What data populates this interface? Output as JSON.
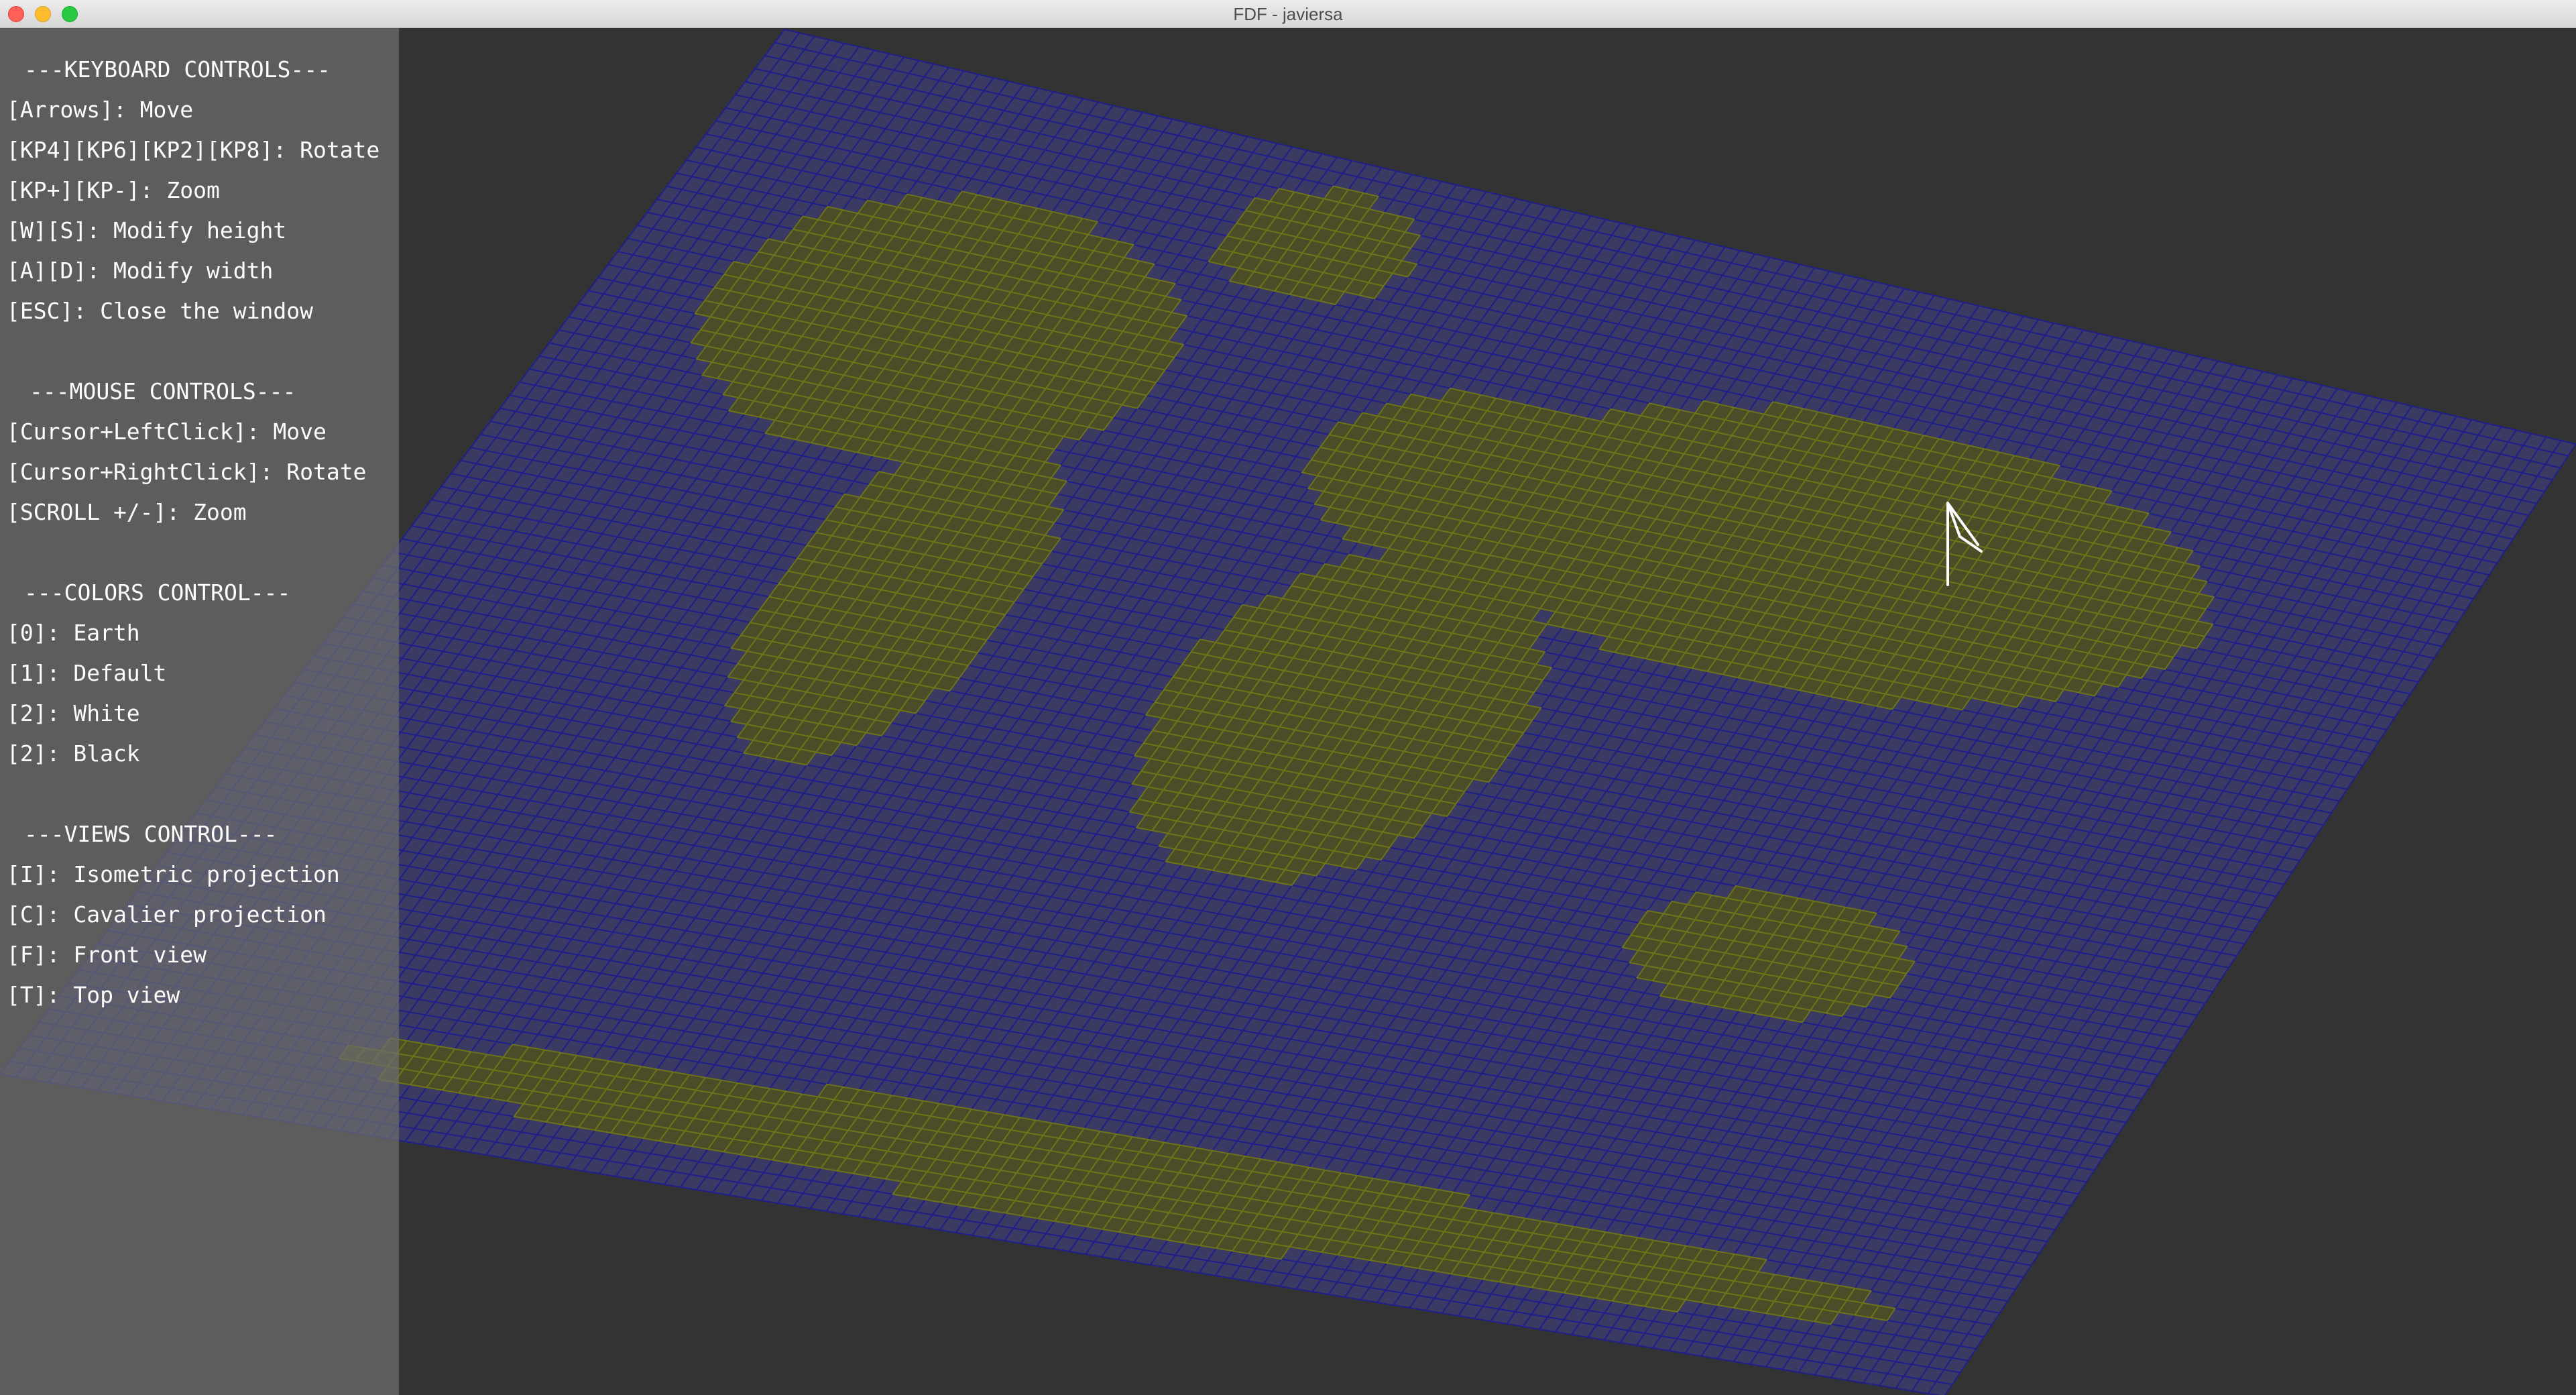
{
  "window": {
    "title": "FDF - javiersa"
  },
  "colors": {
    "background": "#333333",
    "ocean_grid": "#1f1f8a",
    "land_wire": "#6e7318",
    "mountain_wire": "#7a5a1a",
    "panel": "#6e6e6e"
  },
  "controls": {
    "keyboard_heading": "---KEYBOARD CONTROLS---",
    "keyboard": [
      "[Arrows]: Move",
      "[KP4][KP6][KP2][KP8]: Rotate",
      "[KP+][KP-]: Zoom",
      "[W][S]: Modify height",
      "[A][D]: Modify width",
      "[ESC]: Close the window"
    ],
    "mouse_heading": "---MOUSE CONTROLS---",
    "mouse": [
      "[Cursor+LeftClick]: Move",
      "[Cursor+RightClick]: Rotate",
      "[SCROLL +/-]: Zoom"
    ],
    "colors_heading": "---COLORS CONTROL---",
    "colors": [
      "[0]: Earth",
      "[1]: Default",
      "[2]: White",
      "[2]: Black"
    ],
    "views_heading": "---VIEWS CONTROL---",
    "views": [
      "[I]: Isometric projection",
      "[C]: Cavalier projection",
      "[F]: Front view",
      "[T]: Top view"
    ]
  },
  "icons": {
    "cursor": "mouse-pointer-icon"
  }
}
